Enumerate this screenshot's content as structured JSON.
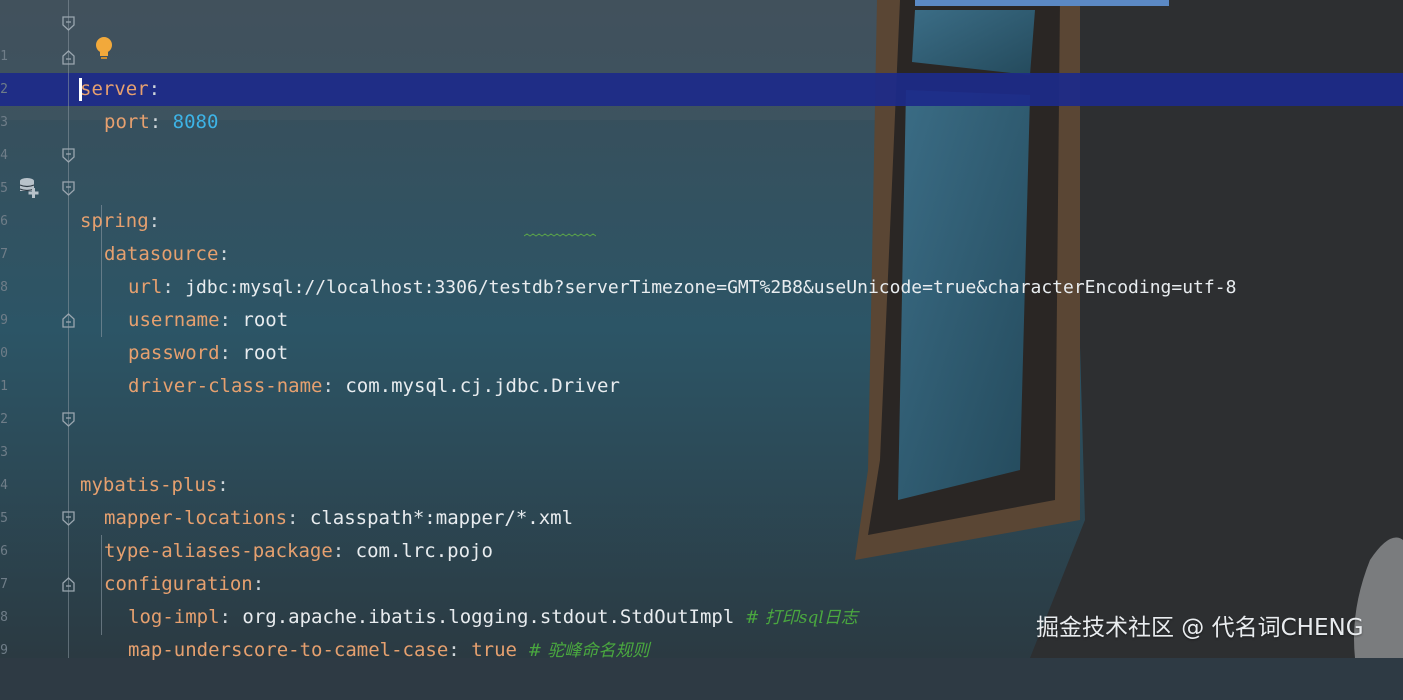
{
  "editor": {
    "line_numbers": [
      "1",
      "2",
      "3",
      "4",
      "5",
      "6",
      "7",
      "8",
      "9",
      "0",
      "1",
      "2",
      "3",
      "4",
      "5",
      "6",
      "7",
      "8",
      "9"
    ],
    "lines": [
      {
        "key": "server",
        "punct": ":"
      },
      {
        "key": "port",
        "punct": ": ",
        "value": "8080"
      },
      {},
      {},
      {
        "key": "spring",
        "punct": ":"
      },
      {
        "key": "datasource",
        "punct": ":"
      },
      {
        "key": "url",
        "punct": ": ",
        "value": "jdbc:mysql://localhost:3306/testdb?serverTimezone=GMT%2B8&useUnicode=true&characterEncoding=utf-8"
      },
      {
        "key": "username",
        "punct": ": ",
        "value": "root"
      },
      {
        "key": "password",
        "punct": ": ",
        "value": "root"
      },
      {
        "key": "driver-class-name",
        "punct": ": ",
        "value": "com.mysql.cj.jdbc.Driver"
      },
      {},
      {},
      {
        "key": "mybatis-plus",
        "punct": ":"
      },
      {
        "key": "mapper-locations",
        "punct": ": ",
        "value": "classpath*:mapper/*.xml"
      },
      {
        "key": "type-aliases-package",
        "punct": ": ",
        "value": "com.lrc.pojo"
      },
      {
        "key": "configuration",
        "punct": ":"
      },
      {
        "key": "log-impl",
        "punct": ": ",
        "value": "org.apache.ibatis.logging.stdout.StdOutImpl",
        "comment": "  # 打印sql日志"
      },
      {
        "key": "map-underscore-to-camel-case",
        "punct": ": ",
        "value": "true",
        "comment": "  # 驼峰命名规则"
      },
      {}
    ]
  },
  "watermark": "掘金技术社区 @ 代名词CHENG",
  "icons": [
    "fold-icon",
    "lightbulb-icon",
    "database-add-icon"
  ],
  "colors": {
    "key": "#e6a06f",
    "number": "#3db3e6",
    "comment": "#4aa83f",
    "current_line": "#1c2a8a"
  }
}
